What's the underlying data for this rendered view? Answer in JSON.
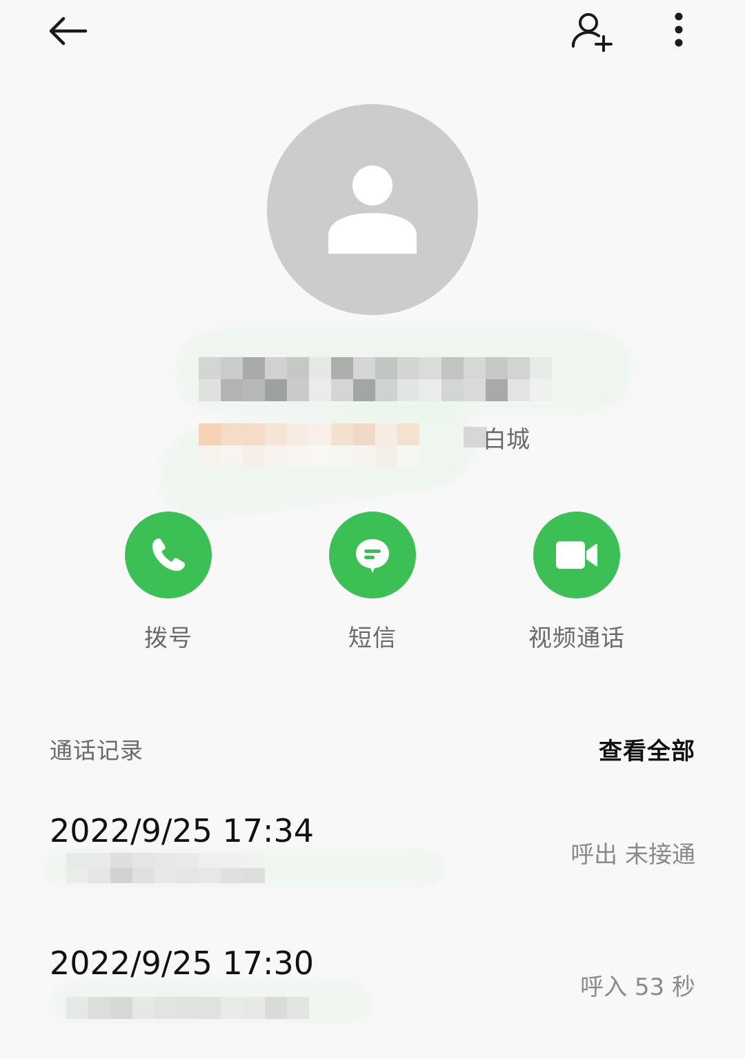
{
  "topbar": {
    "back_icon": "arrow-left-icon",
    "add_contact_icon": "person-add-icon",
    "more_icon": "more-vertical-icon"
  },
  "contact": {
    "avatar_icon": "person-placeholder-icon",
    "location_suffix": "白城"
  },
  "actions": [
    {
      "label": "拨号",
      "icon": "phone-icon"
    },
    {
      "label": "短信",
      "icon": "message-icon"
    },
    {
      "label": "视频通话",
      "icon": "video-call-icon"
    }
  ],
  "call_log": {
    "title": "通话记录",
    "view_all": "查看全部",
    "entries": [
      {
        "time": "2022/9/25 17:34",
        "status": "呼出 未接通"
      },
      {
        "time": "2022/9/25 17:30",
        "status": "呼入  53 秒"
      }
    ]
  },
  "colors": {
    "accent_green": "#3cbf55",
    "avatar_gray": "#cccccc",
    "background": "#f8f8f8"
  }
}
